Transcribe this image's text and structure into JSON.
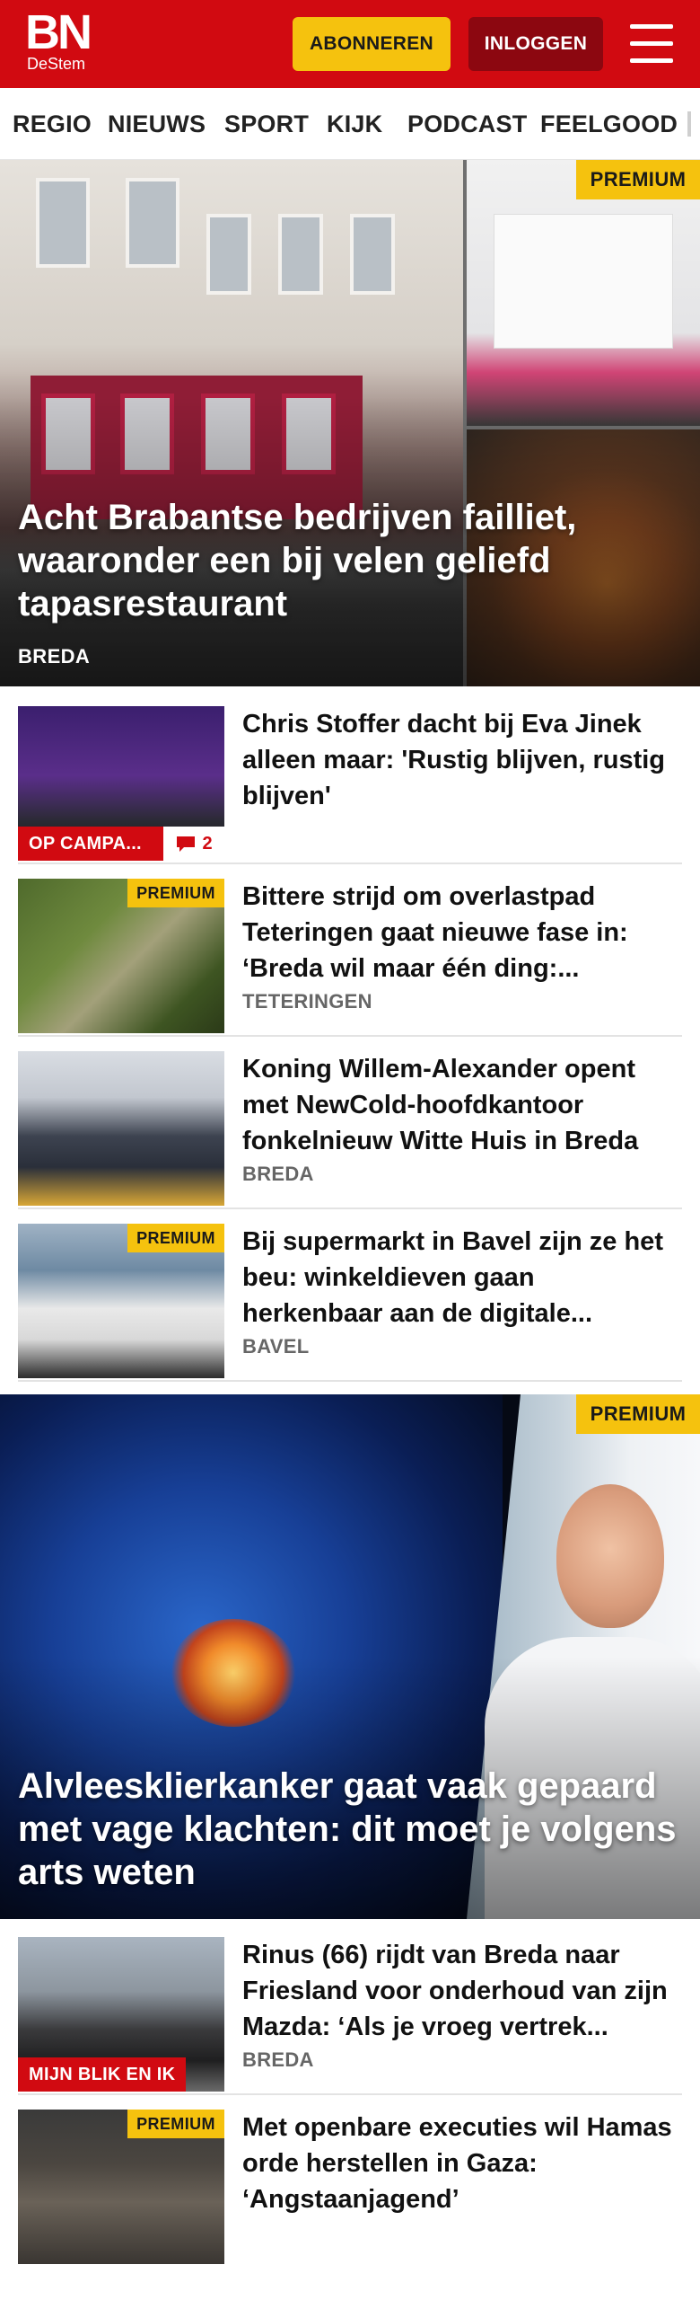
{
  "header": {
    "logo_main": "BN",
    "logo_sub": "DeStem",
    "subscribe_label": "ABONNEREN",
    "login_label": "INLOGGEN",
    "brand_color": "#d10a11",
    "accent_color": "#f5c20e"
  },
  "nav": {
    "items": [
      "REGIO",
      "NIEUWS",
      "SPORT",
      "KIJK",
      "PODCAST",
      "FEELGOOD"
    ]
  },
  "hero": {
    "badge": "PREMIUM",
    "title": "Acht Brabantse bedrijven failliet, waaronder een bij velen geliefd tapasrestaurant",
    "location": "BREDA"
  },
  "articles": [
    {
      "title": "Chris Stoffer dacht bij Eva Jinek alleen maar: 'Rustig blijven, rustig blijven'",
      "tag": "OP CAMPA...",
      "comments": "2"
    },
    {
      "badge": "PREMIUM",
      "title": "Bittere strijd om overlastpad Teteringen gaat nieuwe fase in: ‘Breda wil maar één ding:...",
      "location": "TETERINGEN"
    },
    {
      "title": "Koning Willem-Alexander opent met NewCold-hoofdkantoor fonkelnieuw Witte Huis in Breda",
      "location": "BREDA"
    },
    {
      "badge": "PREMIUM",
      "title": "Bij supermarkt in Bavel zijn ze het beu: winkeldieven gaan herkenbaar aan de digitale...",
      "location": "BAVEL"
    }
  ],
  "feature": {
    "badge": "PREMIUM",
    "title": "Alvleesklierkanker gaat vaak gepaard met vage klachten: dit moet je volgens arts weten"
  },
  "articles2": [
    {
      "title": "Rinus (66) rijdt van Breda naar Friesland voor onderhoud van zijn Mazda: ‘Als je vroeg vertrek...",
      "tag": "MIJN BLIK EN IK",
      "location": "BREDA"
    },
    {
      "badge": "PREMIUM",
      "title": "Met openbare executies wil Hamas orde herstellen in Gaza: ‘Angstaanjagend’"
    }
  ]
}
